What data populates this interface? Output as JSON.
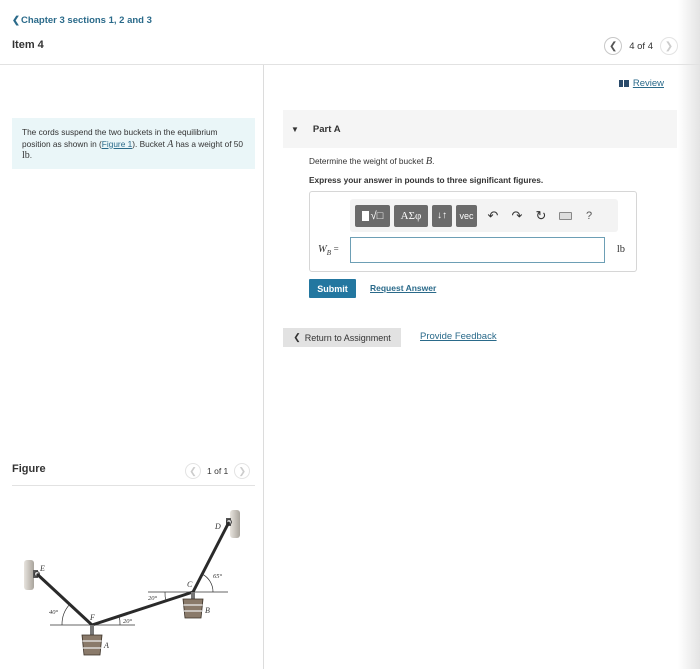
{
  "header": {
    "breadcrumb": "Chapter 3 sections 1, 2 and 3",
    "item_title": "Item 4",
    "pager": {
      "text": "4 of 4",
      "prev_icon": "chevron-left",
      "next_icon": "chevron-right"
    },
    "review_label": "Review"
  },
  "problem": {
    "text_before_link": "The cords suspend the two buckets in the equilibrium position as shown in (",
    "link_text": "Figure 1",
    "text_after_link": "). Bucket ",
    "bucket_var": "A",
    "text_weight": " has a weight of 50 ",
    "unit": "lb",
    "end": "."
  },
  "part": {
    "label": "Part A",
    "question_prefix": "Determine the weight of bucket ",
    "question_var": "B",
    "question_suffix": ".",
    "instruction": "Express your answer in pounds to three significant figures.",
    "toolbar": {
      "templates_icon": "templates-sqrt-icon",
      "greek_label": "ΑΣφ",
      "sort_label": "↓↑",
      "vec_label": "vec",
      "undo_icon": "↶",
      "redo_icon": "↷",
      "reset_icon": "↻",
      "keyboard_icon": "keyboard",
      "help_label": "?"
    },
    "answer": {
      "var": "W",
      "sub": "B",
      "equals": "=",
      "value": "",
      "placeholder": "",
      "unit": "lb"
    },
    "submit_label": "Submit",
    "request_label": "Request Answer"
  },
  "footer": {
    "return_label": "Return to Assignment",
    "feedback_label": "Provide Feedback"
  },
  "figure": {
    "title": "Figure",
    "pager": "1 of 1",
    "labels": {
      "E": "E",
      "F": "F",
      "A": "A",
      "C": "C",
      "D": "D",
      "B": "B",
      "angle_EF": "40°",
      "angle_FC": "20°",
      "angle_CF": "20°",
      "angle_CD": "65°"
    }
  }
}
